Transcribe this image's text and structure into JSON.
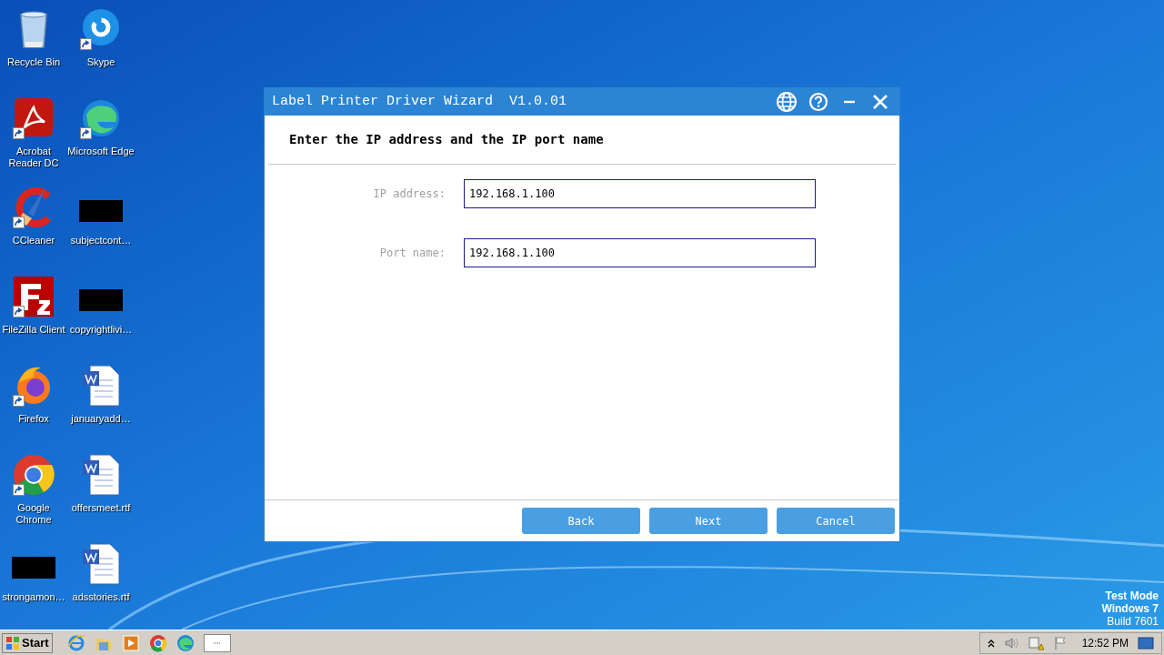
{
  "desktop_icons": [
    {
      "label": "Recycle Bin",
      "kind": "recycle",
      "shortcut": false
    },
    {
      "label": "Skype",
      "kind": "skype",
      "shortcut": true
    },
    {
      "label": "Acrobat Reader DC",
      "kind": "acrobat",
      "shortcut": true
    },
    {
      "label": "Microsoft Edge",
      "kind": "edge",
      "shortcut": true
    },
    {
      "label": "CCleaner",
      "kind": "ccleaner",
      "shortcut": true
    },
    {
      "label": "subjectcont…",
      "kind": "blank",
      "shortcut": false
    },
    {
      "label": "FileZilla Client",
      "kind": "filezilla",
      "shortcut": true
    },
    {
      "label": "copyrightlivi…",
      "kind": "blank",
      "shortcut": false
    },
    {
      "label": "Firefox",
      "kind": "firefox",
      "shortcut": true
    },
    {
      "label": "januaryadd…",
      "kind": "word",
      "shortcut": false
    },
    {
      "label": "Google Chrome",
      "kind": "chrome",
      "shortcut": true
    },
    {
      "label": "offersmeet.rtf",
      "kind": "word",
      "shortcut": false
    },
    {
      "label": "strongamon…",
      "kind": "blank",
      "shortcut": false
    },
    {
      "label": "adsstories.rtf",
      "kind": "word",
      "shortcut": false
    }
  ],
  "window": {
    "title": "Label Printer Driver Wizard  V1.0.01",
    "heading": "Enter the IP address and the IP port name",
    "fields": [
      {
        "label": "IP address:",
        "value": "192.168.1.100"
      },
      {
        "label": "Port name:",
        "value": "192.168.1.100"
      }
    ],
    "buttons": [
      "Back",
      "Next",
      "Cancel"
    ]
  },
  "watermark_text": [
    "Test Mode",
    "Windows 7",
    "Build 7601"
  ],
  "taskbar": {
    "start": "Start",
    "pinned": [
      {
        "kind": "ie"
      },
      {
        "kind": "folder"
      },
      {
        "kind": "media"
      },
      {
        "kind": "chrome"
      },
      {
        "kind": "edge"
      },
      {
        "kind": "window"
      }
    ],
    "clock": "12:52 PM"
  }
}
